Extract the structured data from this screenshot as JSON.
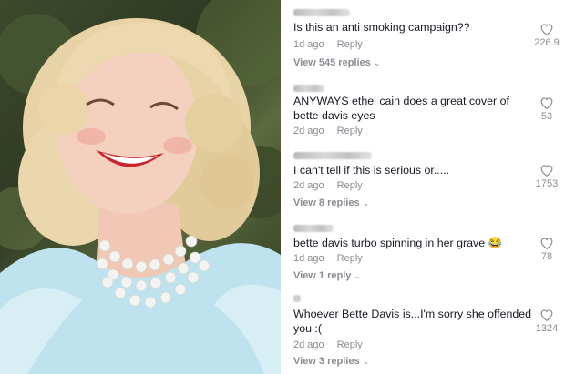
{
  "comments": [
    {
      "text": "Is this an anti smoking campaign??",
      "age": "1d ago",
      "reply_label": "Reply",
      "likes": "226.9",
      "replies_link": "View 545 replies"
    },
    {
      "text": "ANYWAYS ethel cain does a great cover of bette davis eyes",
      "age": "2d ago",
      "reply_label": "Reply",
      "likes": "53",
      "replies_link": ""
    },
    {
      "text": "I can't tell if this is serious or.....",
      "age": "2d ago",
      "reply_label": "Reply",
      "likes": "1753",
      "replies_link": "View 8 replies"
    },
    {
      "text": "bette davis turbo spinning in her grave 😂",
      "age": "1d ago",
      "reply_label": "Reply",
      "likes": "78",
      "replies_link": "View 1 reply"
    },
    {
      "text": "Whoever Bette Davis is...I'm sorry she offended you :(",
      "age": "2d ago",
      "reply_label": "Reply",
      "likes": "1324",
      "replies_link": "View 3 replies"
    }
  ],
  "icons": {
    "like": "heart-icon",
    "expand": "chevron-down-icon"
  },
  "colors": {
    "text": "#161823",
    "secondary": "#8a8b91",
    "lipstick": "#c8242c",
    "dress": "#bfe3ee"
  }
}
